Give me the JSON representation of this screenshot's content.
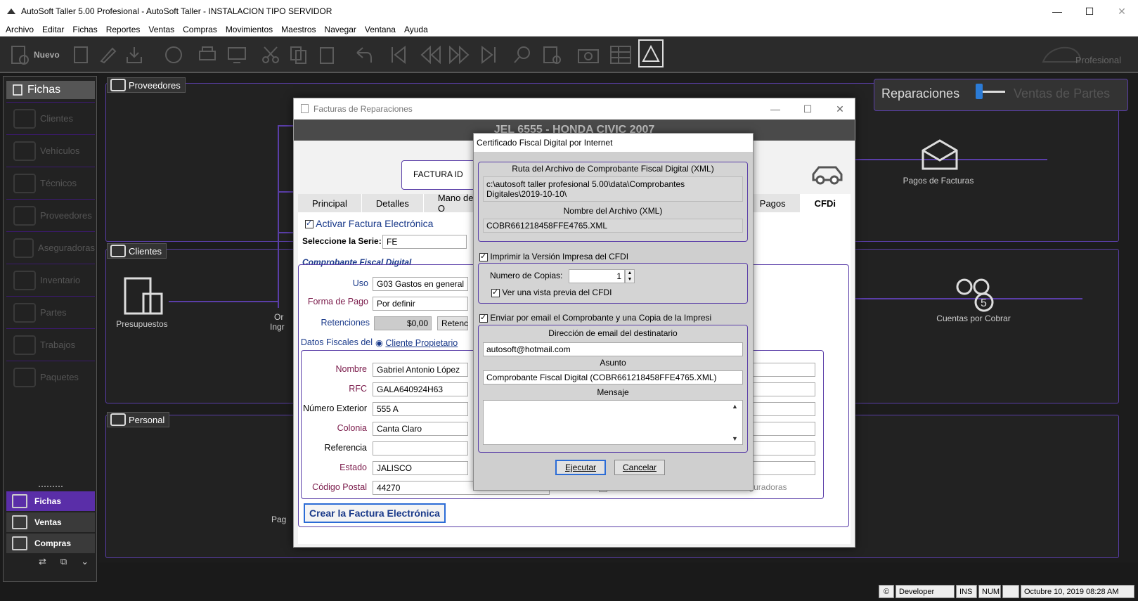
{
  "window": {
    "title": "AutoSoft Taller 5.00 Profesional - AutoSoft Taller - INSTALACION TIPO SERVIDOR"
  },
  "menu": [
    "Archivo",
    "Editar",
    "Fichas",
    "Reportes",
    "Ventas",
    "Compras",
    "Movimientos",
    "Maestros",
    "Navegar",
    "Ventana",
    "Ayuda"
  ],
  "toolbar": {
    "new_label": "Nuevo",
    "edition_label": "Profesional"
  },
  "sidebar": {
    "header": "Fichas",
    "items": [
      "Clientes",
      "Vehículos",
      "Técnicos",
      "Proveedores",
      "Aseguradoras",
      "Inventario",
      "Partes",
      "Trabajos",
      "Paquetes"
    ],
    "bottom_buttons": [
      "Fichas",
      "Ventas",
      "Compras"
    ]
  },
  "mode_switch": {
    "left": "Reparaciones",
    "right": "Ventas de Partes"
  },
  "panels": {
    "proveedores": "Proveedores",
    "clientes": "Clientes",
    "personal": "Personal",
    "pagos_facturas": "Pagos de Facturas",
    "presupuestos": "Presupuestos",
    "cuentas_cobrar": "Cuentas por Cobrar",
    "or_fragment": "Or",
    "ingr_fragment": "Ingr",
    "pag_fragment": "Pag"
  },
  "facturas": {
    "title": "Facturas de Reparaciones",
    "header": "JEL 6555 - HONDA CIVIC 2007",
    "factura_id_label": "FACTURA ID",
    "tabs": [
      "Principal",
      "Detalles",
      "Mano de O",
      "Pagos",
      "CFDi"
    ],
    "activar_label": "Activar Factura Electrónica",
    "serie_label": "Seleccione la Serie:",
    "serie_value": "FE",
    "cfd_section": "Comprobante Fiscal Digital",
    "uso_label": "Uso",
    "uso_value": "G03 Gastos en general",
    "forma_pago_label": "Forma de Pago",
    "forma_pago_value": "Por definir",
    "retenciones_label": "Retenciones",
    "retenciones_value": "$0,00",
    "retenc_btn": "Retenc",
    "datos_fiscales_label": "Datos Fiscales del",
    "cliente_propietario": "Cliente Propietario",
    "nombre_label": "Nombre",
    "nombre_value": "Gabriel Antonio López",
    "rfc_label": "RFC",
    "rfc_value": "GALA640924H63",
    "num_ext_label": "Número Exterior",
    "num_ext_value": "555 A",
    "colonia_label": "Colonia",
    "colonia_value": "Canta Claro",
    "referencia_label": "Referencia",
    "referencia_value": "",
    "estado_label": "Estado",
    "estado_value": "JALISCO",
    "cp_label": "Código Postal",
    "cp_value": "44270",
    "addenda_label": "Incluir la Addenda AMIS Para las Aseguradoras",
    "crear_btn": "Crear la Factura Electrónica"
  },
  "cfdi": {
    "title": "Certificado Fiscal Digital por Internet",
    "ruta_caption": "Ruta del Archivo de Comprobante Fiscal Digital (XML)",
    "ruta_line1": "c:\\autosoft taller profesional 5.00\\data\\Comprobantes",
    "ruta_line2": "Digitales\\2019-10-10\\",
    "nombre_caption": "Nombre del Archivo (XML)",
    "nombre_value": "COBR661218458FFE4765.XML",
    "imprimir_label": "Imprimir la Versión Impresa del CFDI",
    "copias_label": "Numero de Copias:",
    "copias_value": "1",
    "vista_previa_label": "Ver una vista previa del CFDI",
    "enviar_label": "Enviar por email el Comprobante  y una Copia de la Impresi",
    "email_caption": "Dirección de email del destinatario",
    "email_value": "autosoft@hotmail.com",
    "asunto_caption": "Asunto",
    "asunto_value": "Comprobante Fiscal Digital (COBR661218458FFE4765.XML)",
    "mensaje_caption": "Mensaje",
    "mensaje_value": "",
    "ejecutar_btn": "Ejecutar",
    "cancelar_btn": "Cancelar"
  },
  "status": {
    "user": "Developer",
    "ins": "INS",
    "num": "NUM",
    "datetime": "Octubre 10, 2019 08:28 AM"
  }
}
